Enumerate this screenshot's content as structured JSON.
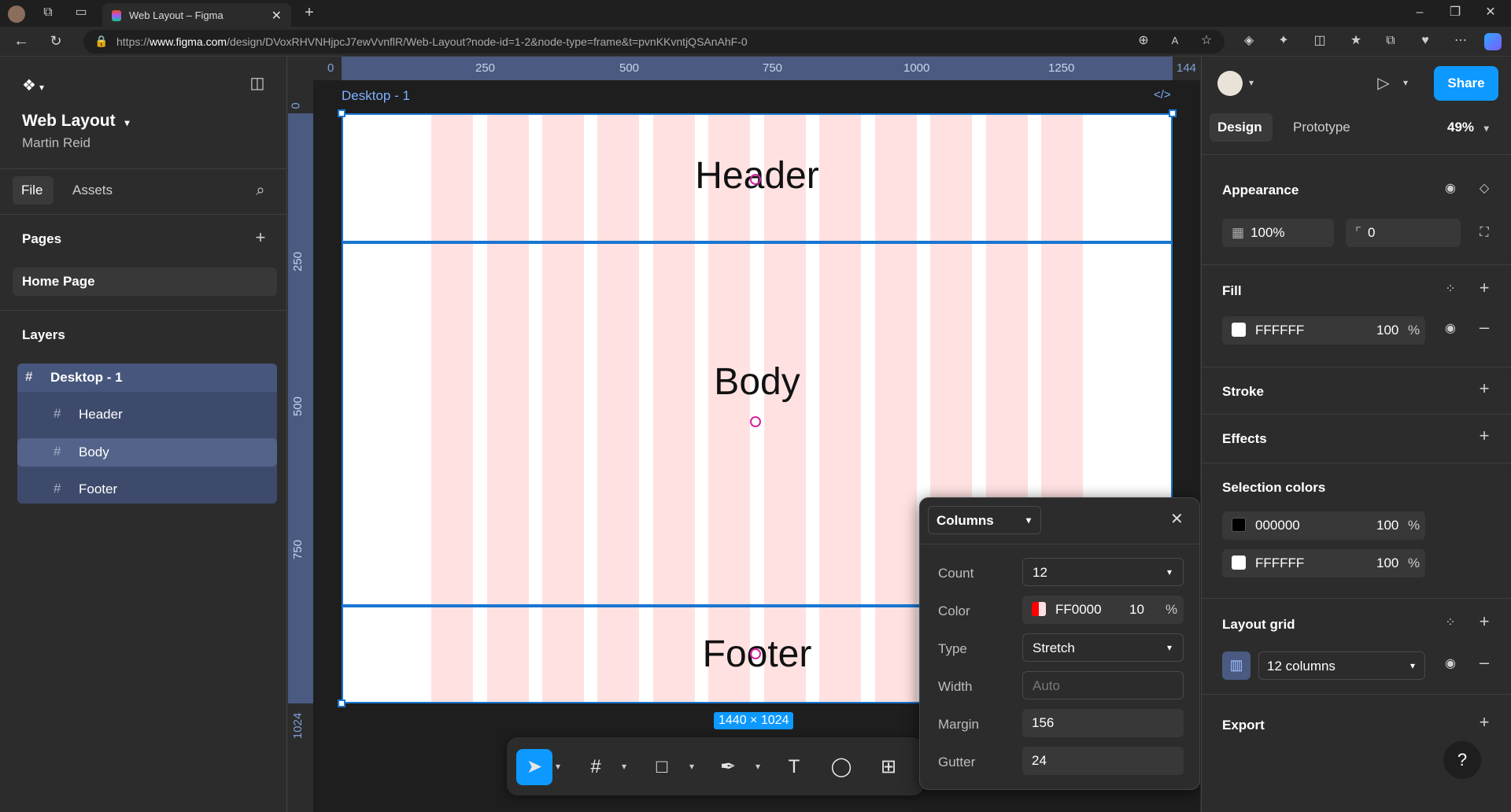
{
  "browser": {
    "tab_title": "Web Layout – Figma",
    "url_prefix": "https://",
    "url_domain": "www.figma.com",
    "url_rest": "/design/DVoxRHVNHjpcJ7ewVvnflR/Web-Layout?node-id=1-2&node-type=frame&t=pvnKKvntjQSAnAhF-0"
  },
  "file": {
    "name": "Web Layout",
    "owner": "Martin Reid"
  },
  "left_tabs": {
    "file": "File",
    "assets": "Assets"
  },
  "pages": {
    "title": "Pages",
    "items": [
      "Home Page"
    ]
  },
  "layers": {
    "title": "Layers",
    "items": [
      {
        "label": "Desktop - 1"
      },
      {
        "label": "Header"
      },
      {
        "label": "Body"
      },
      {
        "label": "Footer"
      }
    ]
  },
  "rulers": {
    "h_ticks": [
      "0",
      "250",
      "500",
      "750",
      "1000",
      "1250",
      "144"
    ],
    "v_ticks": [
      "0",
      "250",
      "500",
      "750",
      "1024"
    ]
  },
  "canvas": {
    "frame_label": "Desktop - 1",
    "frame_size": "1440 × 1024",
    "sections": {
      "header": "Header",
      "body": "Body",
      "footer": "Footer"
    }
  },
  "header_bar": {
    "share": "Share",
    "tabs": {
      "design": "Design",
      "prototype": "Prototype"
    },
    "zoom": "49%"
  },
  "appearance": {
    "title": "Appearance",
    "opacity": "100%",
    "radius": "0"
  },
  "fill": {
    "title": "Fill",
    "hex": "FFFFFF",
    "opacity": "100",
    "unit": "%"
  },
  "stroke": {
    "title": "Stroke"
  },
  "effects": {
    "title": "Effects"
  },
  "selection_colors": {
    "title": "Selection colors",
    "items": [
      {
        "hex": "000000",
        "opacity": "100",
        "unit": "%",
        "color": "#000000"
      },
      {
        "hex": "FFFFFF",
        "opacity": "100",
        "unit": "%",
        "color": "#FFFFFF"
      }
    ]
  },
  "layout_grid": {
    "title": "Layout grid",
    "value": "12 columns"
  },
  "export": {
    "title": "Export"
  },
  "help": "?",
  "popover": {
    "type_select": "Columns",
    "rows": {
      "count_label": "Count",
      "count": "12",
      "color_label": "Color",
      "color_hex": "FF0000",
      "color_opacity": "10",
      "color_unit": "%",
      "type_label": "Type",
      "type": "Stretch",
      "width_label": "Width",
      "width_placeholder": "Auto",
      "margin_label": "Margin",
      "margin": "156",
      "gutter_label": "Gutter",
      "gutter": "24"
    }
  },
  "colors": {
    "accent": "#0d99ff",
    "selection": "#1976d2",
    "grid_column": "#ffe1e1",
    "layer_highlight": "#3d4a6b"
  }
}
